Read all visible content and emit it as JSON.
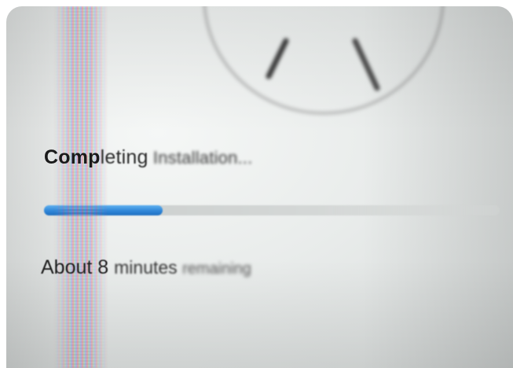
{
  "installer": {
    "title_parts": [
      "Comp",
      "leting",
      " Installation..."
    ],
    "status_parts": [
      "About 8 ",
      "minutes ",
      "remaining"
    ],
    "progress": 0.26
  },
  "colors": {
    "progress_fill": "#2f86d8",
    "progress_track": "#d0d4d3",
    "text": "#1a1a1a"
  },
  "icons": {
    "logo": "installer-logo-icon"
  }
}
